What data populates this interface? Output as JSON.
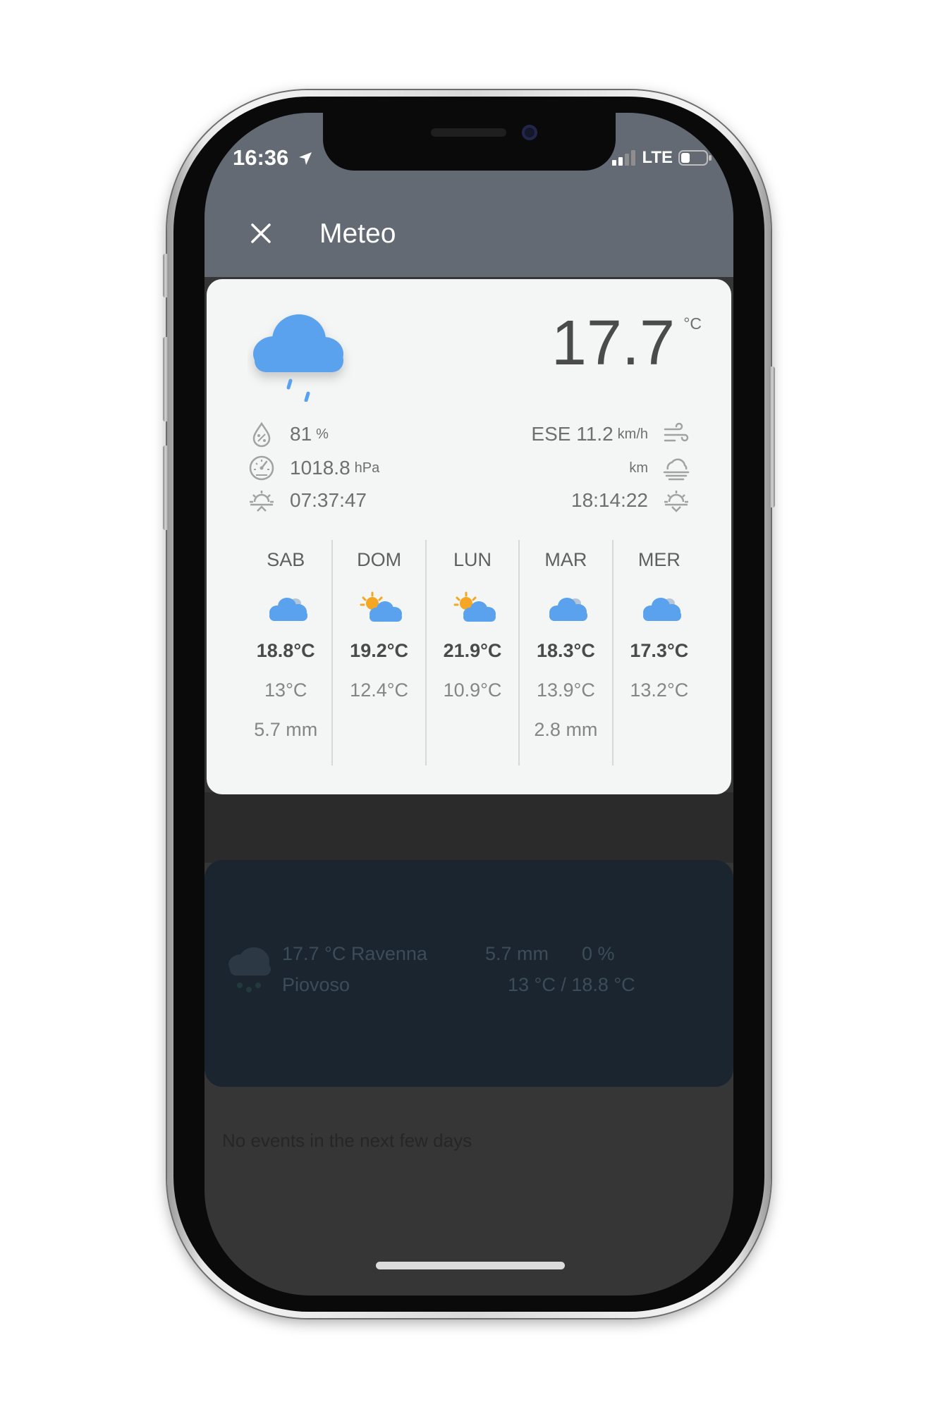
{
  "status_bar": {
    "time": "16:36",
    "network": "LTE"
  },
  "header": {
    "title": "Meteo",
    "close_icon": "close-icon"
  },
  "weather": {
    "current_temp": "17.7",
    "temp_unit": "°C",
    "icon": "rain-cloud-icon",
    "humidity": {
      "value": "81",
      "unit": "%"
    },
    "pressure": {
      "value": "1018.8",
      "unit": "hPa"
    },
    "sunrise": "07:37:47",
    "wind": {
      "value": "ESE 11.2",
      "unit": "km/h"
    },
    "visibility": {
      "value": "",
      "unit": "km"
    },
    "sunset": "18:14:22",
    "colors": {
      "accent": "#5aa1ee",
      "sun": "#f5a623"
    }
  },
  "forecast": [
    {
      "day": "SAB",
      "icon": "cloud-icon",
      "max": "18.8°C",
      "min": "13°C",
      "rain": "5.7 mm"
    },
    {
      "day": "DOM",
      "icon": "sun-cloud-icon",
      "max": "19.2°C",
      "min": "12.4°C",
      "rain": ""
    },
    {
      "day": "LUN",
      "icon": "sun-cloud-icon",
      "max": "21.9°C",
      "min": "10.9°C",
      "rain": ""
    },
    {
      "day": "MAR",
      "icon": "cloud-icon",
      "max": "18.3°C",
      "min": "13.9°C",
      "rain": "2.8 mm"
    },
    {
      "day": "MER",
      "icon": "cloud-icon",
      "max": "17.3°C",
      "min": "13.2°C",
      "rain": ""
    }
  ],
  "background": {
    "card": {
      "line1_left": "17.7 °C Ravenna",
      "line2_left": "Piovoso",
      "line1_right": "5.7 mm",
      "line1_right_extra": "0 %",
      "line2_right": "13 °C / 18.8 °C"
    },
    "no_events": "No events in the next few days"
  }
}
